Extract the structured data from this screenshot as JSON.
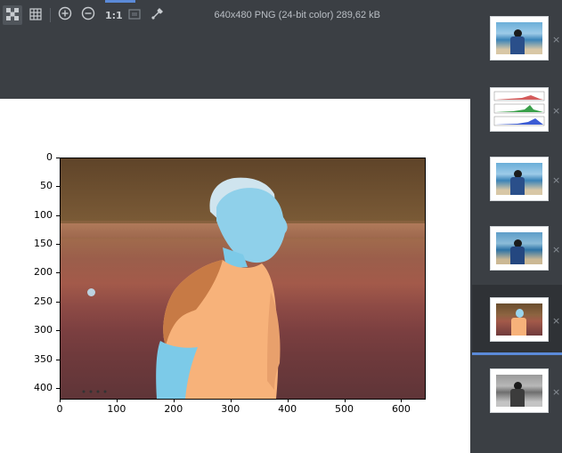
{
  "toolbar": {
    "actual_size_label": "1:1",
    "image_info": "640x480 PNG (24-bit color) 289,62 kB",
    "tools": [
      {
        "name": "chessboard",
        "active": true
      },
      {
        "name": "grid"
      },
      {
        "name": "zoom-in"
      },
      {
        "name": "zoom-out"
      },
      {
        "name": "actual-size"
      },
      {
        "name": "fit-zoom"
      },
      {
        "name": "color-picker"
      }
    ]
  },
  "colors": {
    "accent": "#5b8ad8",
    "panel_bg": "#3b3f44",
    "selected_bg": "#2f3236"
  },
  "figure": {
    "y_ticks": [
      "0",
      "50",
      "100",
      "150",
      "200",
      "250",
      "300",
      "350",
      "400"
    ],
    "x_ticks": [
      "0",
      "100",
      "200",
      "300",
      "400",
      "500",
      "600"
    ]
  },
  "thumbnails": [
    {
      "name": "photo-original",
      "close": "×"
    },
    {
      "name": "histogram-plot",
      "close": "×"
    },
    {
      "name": "photo-variant-1",
      "close": "×"
    },
    {
      "name": "photo-variant-2",
      "close": "×"
    },
    {
      "name": "inverted-photo",
      "close": "×",
      "selected": true
    },
    {
      "name": "grayscale-photo",
      "close": "×"
    }
  ]
}
